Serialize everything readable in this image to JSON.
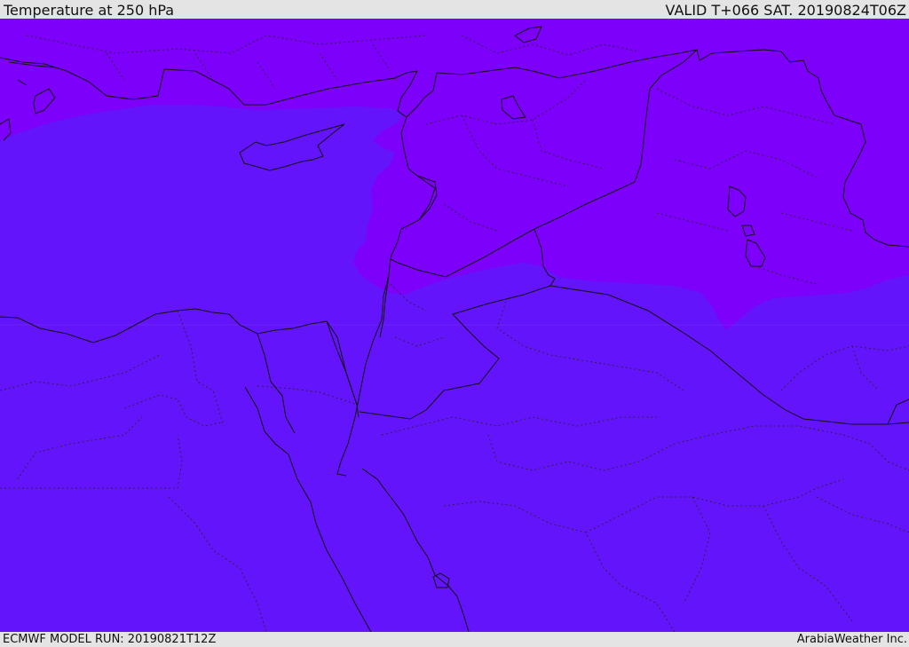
{
  "header": {
    "title": "Temperature at 250 hPa",
    "valid_time": "VALID T+066 SAT. 20190824T06Z"
  },
  "footer": {
    "model_run": "ECMWF MODEL RUN: 20190821T12Z",
    "credit": "ArabiaWeather Inc."
  },
  "colors": {
    "warmer_band": "#6414fa",
    "colder_band": "#7d00fa",
    "coastline": "#111111",
    "panel_background": "#e4e4e4"
  }
}
